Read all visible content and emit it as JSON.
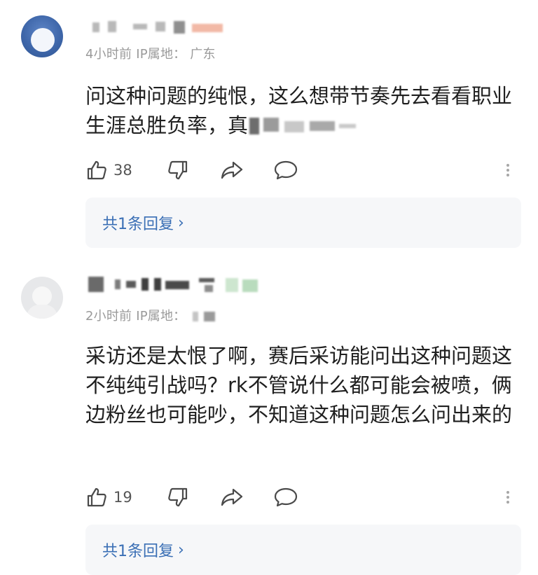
{
  "comments": [
    {
      "time": "4小时前",
      "ip_label": "IP属地：",
      "ip_location": "广东",
      "content_visible": "问这种问题的纯恨，这么想带节奏先去看看职业生涯总胜负率，真",
      "likes": "38",
      "reply_summary": "共1条回复"
    },
    {
      "time": "2小时前",
      "ip_label": "IP属地：",
      "ip_location": "",
      "content_visible": "采访还是太恨了啊，赛后采访能问出这种问题这不纯纯引战吗？rk不管说什么都可能会被喷，俩边粉丝也可能吵，不知道这种问题怎么问出来的",
      "likes": "19",
      "reply_summary": "共1条回复"
    }
  ],
  "icons": {
    "like": "thumbs-up-icon",
    "dislike": "thumbs-down-icon",
    "share": "share-arrow-icon",
    "reply": "comment-bubble-icon",
    "more": "more-vertical-icon",
    "chevron": "chevron-right-icon"
  },
  "chevron_glyph": "›",
  "colors": {
    "link_blue": "#3a6fb5",
    "meta_gray": "#9a9a9a",
    "reply_bg": "#f6f7f9"
  }
}
